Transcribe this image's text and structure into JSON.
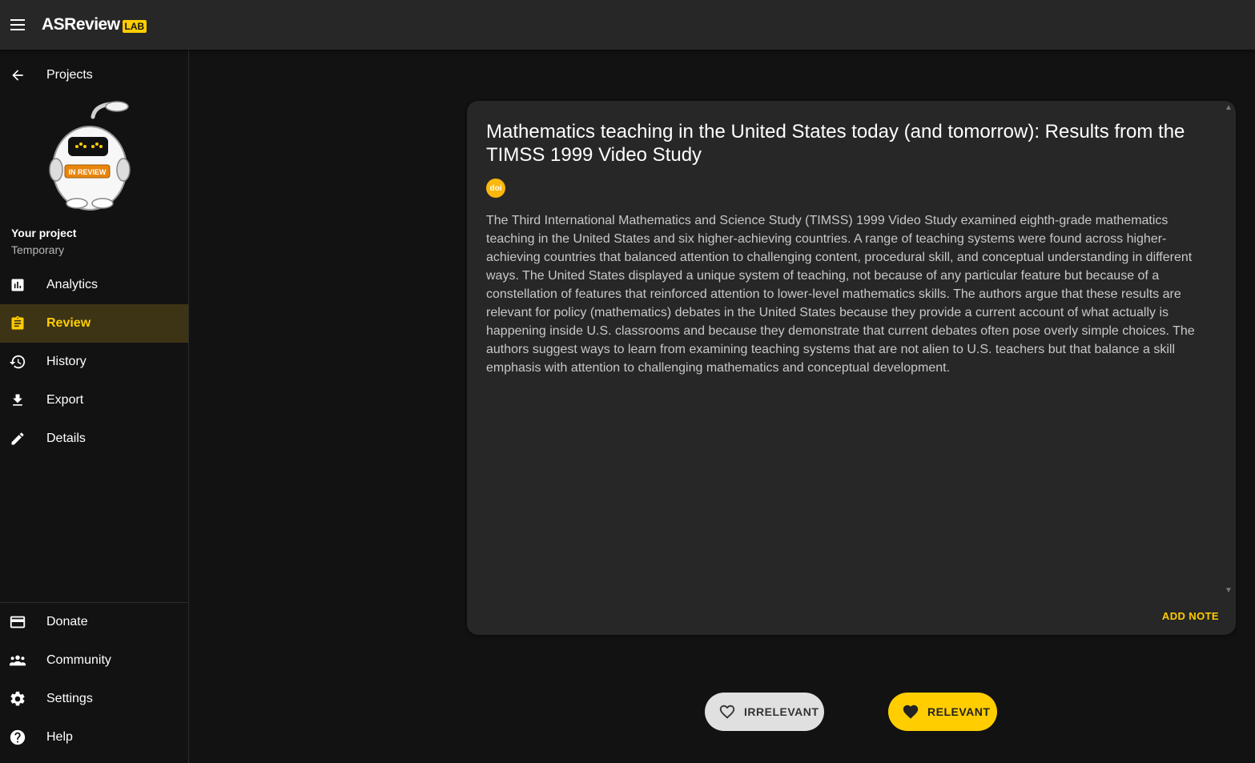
{
  "app": {
    "logo_text": "ASReview",
    "logo_badge": "LAB"
  },
  "sidebar": {
    "back_label": "Projects",
    "project_title": "Your project",
    "project_subtitle": "Temporary",
    "robot_badge": "IN REVIEW",
    "items": [
      {
        "label": "Analytics",
        "icon": "analytics-icon"
      },
      {
        "label": "Review",
        "icon": "review-icon",
        "active": true
      },
      {
        "label": "History",
        "icon": "history-icon"
      },
      {
        "label": "Export",
        "icon": "download-icon"
      },
      {
        "label": "Details",
        "icon": "edit-icon"
      }
    ],
    "bottom_items": [
      {
        "label": "Donate",
        "icon": "credit-card-icon"
      },
      {
        "label": "Community",
        "icon": "people-icon"
      },
      {
        "label": "Settings",
        "icon": "gear-icon"
      },
      {
        "label": "Help",
        "icon": "help-icon"
      }
    ]
  },
  "record": {
    "title": "Mathematics teaching in the United States today (and tomorrow): Results from the TIMSS 1999 Video Study",
    "doi_label": "doi",
    "abstract": "The Third International Mathematics and Science Study (TIMSS) 1999 Video Study examined eighth-grade mathematics teaching in the United States and six higher-achieving countries. A range of teaching systems were found across higher-achieving countries that balanced attention to challenging content, procedural skill, and conceptual understanding in different ways. The United States displayed a unique system of teaching, not because of any particular feature but because of a constellation of features that reinforced attention to lower-level mathematics skills. The authors argue that these results are relevant for policy (mathematics) debates in the United States because they provide a current account of what actually is happening inside U.S. classrooms and because they demonstrate that current debates often pose overly simple choices. The authors suggest ways to learn from examining teaching systems that are not alien to U.S. teachers but that balance a skill emphasis with attention to challenging mathematics and conceptual development.",
    "add_note_label": "ADD NOTE"
  },
  "actions": {
    "irrelevant_label": "IRRELEVANT",
    "relevant_label": "RELEVANT"
  },
  "colors": {
    "accent": "#FFCD00",
    "background": "#121212",
    "surface": "#272727",
    "doi": "#FAB70C"
  }
}
